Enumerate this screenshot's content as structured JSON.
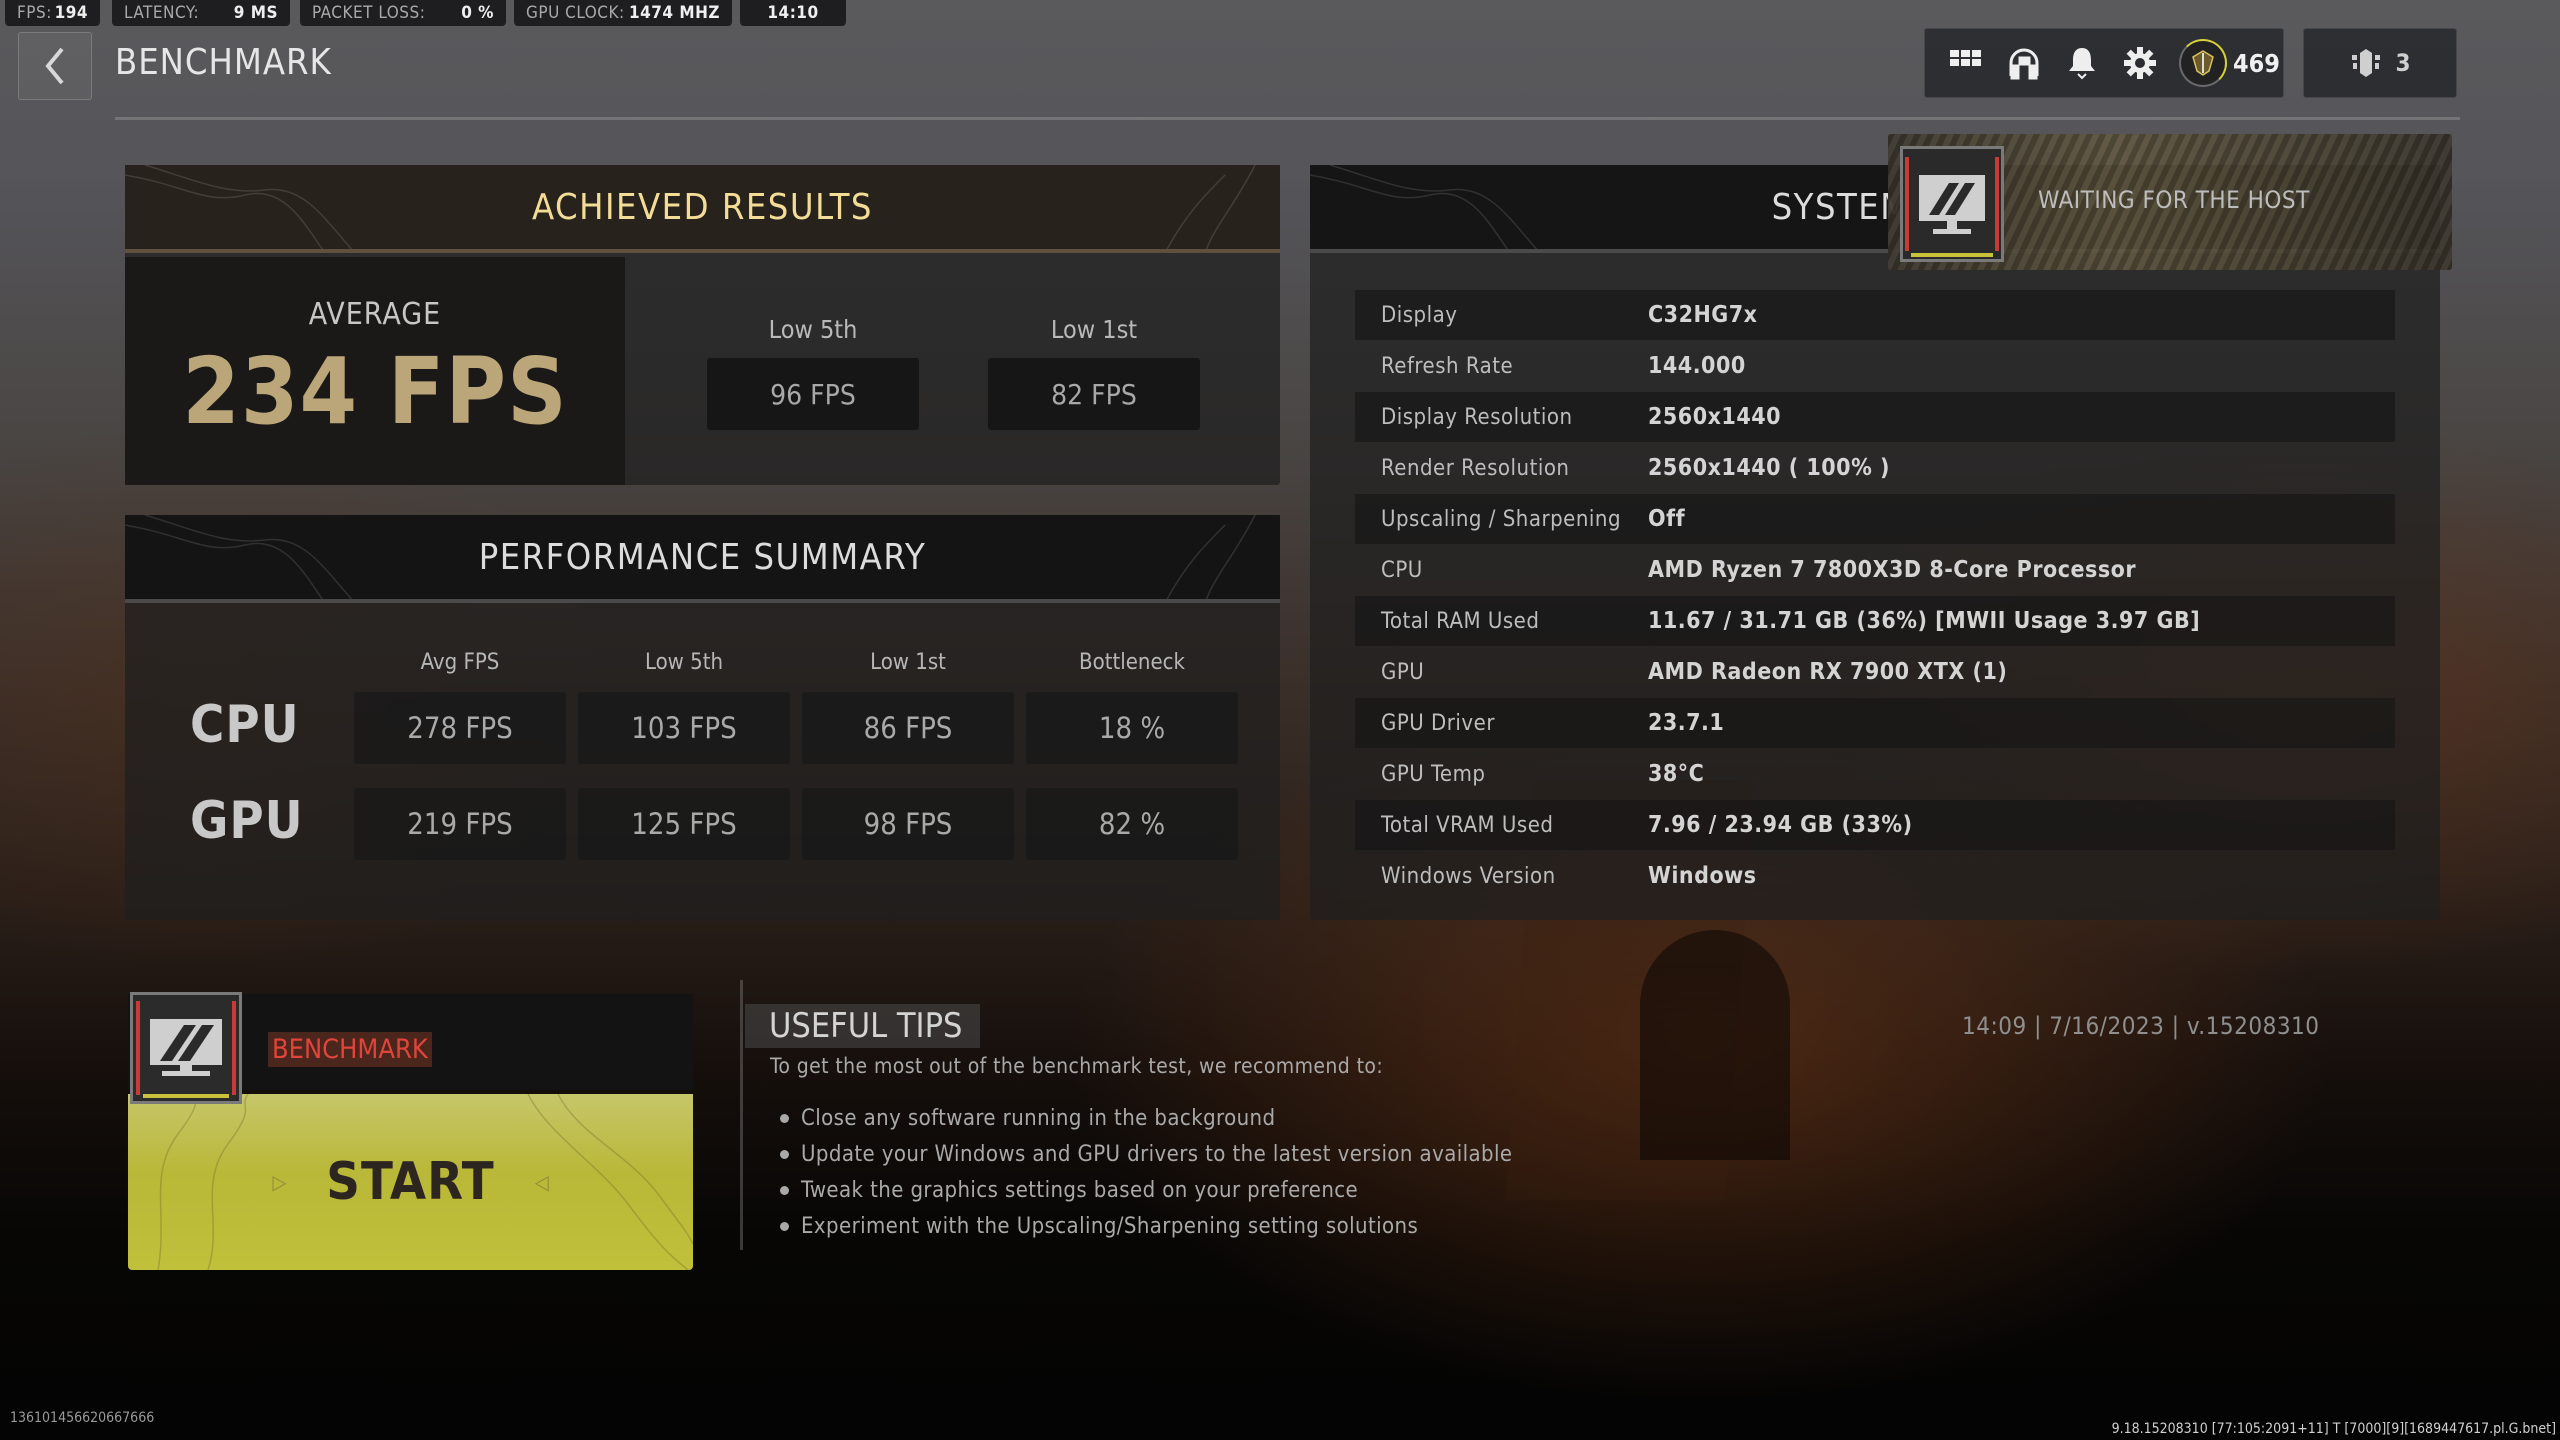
{
  "overlay_stats": [
    {
      "label": "FPS:",
      "value": "194"
    },
    {
      "label": "LATENCY:",
      "value": "9 MS"
    },
    {
      "label": "PACKET LOSS:",
      "value": "0 %"
    },
    {
      "label": "GPU CLOCK:",
      "value": "1474  MHZ"
    },
    {
      "label": "",
      "value": "14:10"
    }
  ],
  "header": {
    "title": "BENCHMARK",
    "back_icon": "chevron-left-icon",
    "toolbar_icons": [
      "grid-menu-icon",
      "headset-icon",
      "bell-icon",
      "gear-icon"
    ],
    "prestige_level": "469",
    "party_count": "3",
    "accent_color": "#d6d13a"
  },
  "achieved_results": {
    "title": "ACHIEVED RESULTS",
    "average_label": "AVERAGE",
    "average_value": "234 FPS",
    "low5_label": "Low 5th",
    "low5_value": "96 FPS",
    "low1_label": "Low 1st",
    "low1_value": "82 FPS"
  },
  "performance_summary": {
    "title": "PERFORMANCE SUMMARY",
    "columns": [
      "Avg FPS",
      "Low 5th",
      "Low 1st",
      "Bottleneck"
    ],
    "rows": [
      {
        "label": "CPU",
        "values": [
          "278 FPS",
          "103 FPS",
          "86 FPS",
          "18 %"
        ]
      },
      {
        "label": "GPU",
        "values": [
          "219 FPS",
          "125 FPS",
          "98 FPS",
          "82 %"
        ]
      }
    ]
  },
  "system_info": {
    "title": "SYSTEM INF",
    "rows": [
      {
        "label": "Display",
        "value": "C32HG7x"
      },
      {
        "label": "Refresh Rate",
        "value": "144.000"
      },
      {
        "label": "Display Resolution",
        "value": "2560x1440"
      },
      {
        "label": "Render Resolution",
        "value": "2560x1440 ( 100% )"
      },
      {
        "label": "Upscaling / Sharpening",
        "value": "Off"
      },
      {
        "label": "CPU",
        "value": "AMD Ryzen 7 7800X3D 8-Core Processor"
      },
      {
        "label": "Total RAM Used",
        "value": "11.67 / 31.71 GB (36%) [MWII Usage 3.97 GB]"
      },
      {
        "label": "GPU",
        "value": "AMD Radeon RX 7900 XTX (1)"
      },
      {
        "label": "GPU Driver",
        "value": "23.7.1"
      },
      {
        "label": "GPU Temp",
        "value": "38°C"
      },
      {
        "label": "Total VRAM Used",
        "value": "7.96 / 23.94 GB (33%)"
      },
      {
        "label": "Windows Version",
        "value": "Windows"
      }
    ]
  },
  "host_card": {
    "status": "WAITING FOR THE HOST"
  },
  "benchmark_card": {
    "tag": "BENCHMARK",
    "start_label": "START",
    "start_color": "#c0bf3c",
    "tag_color": "#e0443a"
  },
  "tips": {
    "title": "USEFUL TIPS",
    "intro": "To get the most out of the benchmark test, we recommend to:",
    "items": [
      "Close any software running in the background",
      "Update your Windows and GPU drivers to the latest version available",
      "Tweak the graphics settings based on your preference",
      "Experiment with the Upscaling/Sharpening setting solutions"
    ]
  },
  "version_line": "14:09 | 7/16/2023 | v.15208310",
  "footer": {
    "left_id": "136101456620667666",
    "right_build": "9.18.15208310 [77:105:2091+11] T [7000][9][1689447617.pl.G.bnet]"
  }
}
